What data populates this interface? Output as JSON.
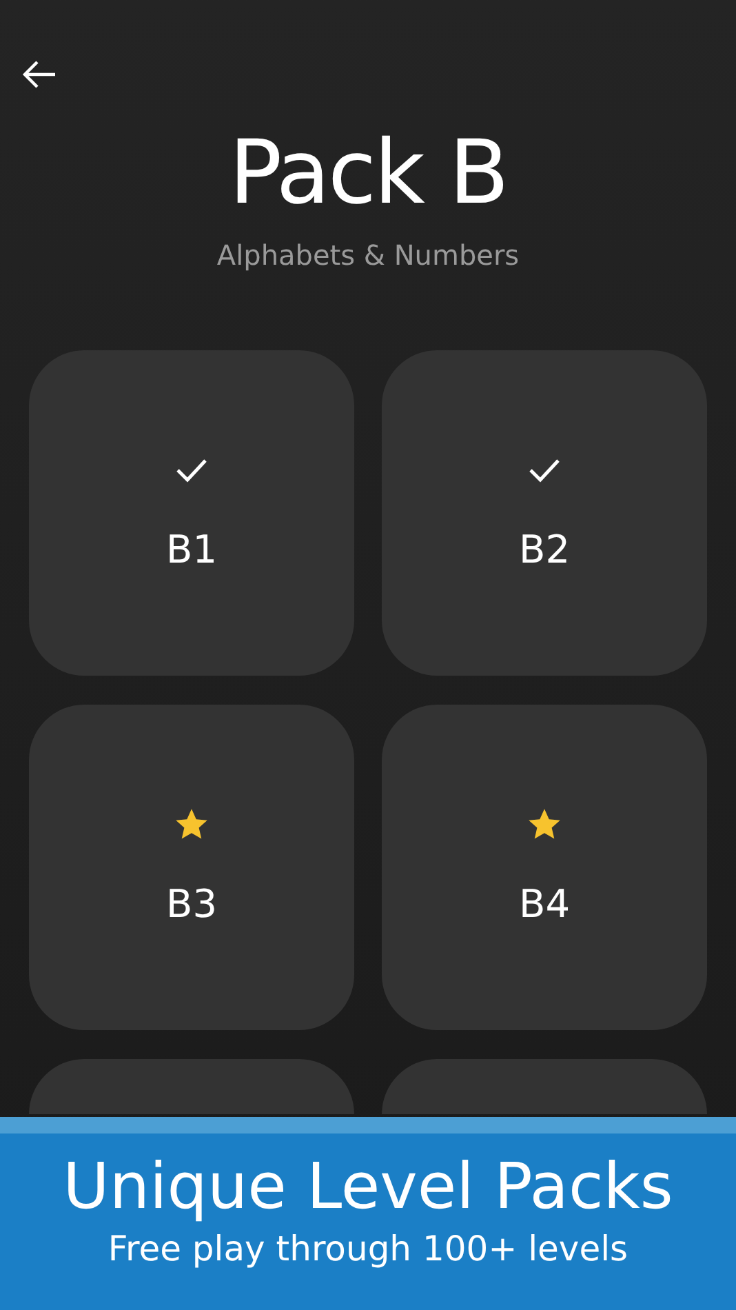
{
  "header": {
    "title": "Pack B",
    "subtitle": "Alphabets & Numbers"
  },
  "levels": [
    {
      "label": "B1",
      "kind": "completed"
    },
    {
      "label": "B2",
      "kind": "completed"
    },
    {
      "label": "B3",
      "kind": "starred"
    },
    {
      "label": "B4",
      "kind": "starred"
    },
    {
      "kind": "partial"
    },
    {
      "kind": "partial"
    }
  ],
  "banner": {
    "title": "Unique Level Packs",
    "subtitle": "Free play through 100+ levels"
  }
}
